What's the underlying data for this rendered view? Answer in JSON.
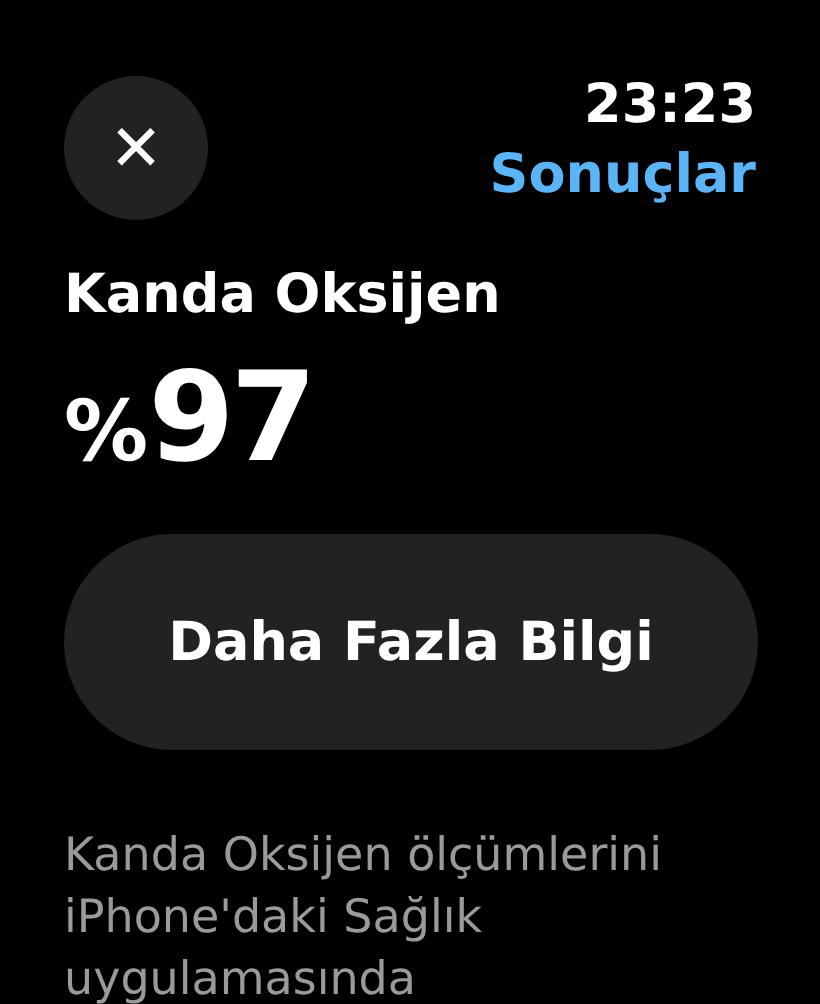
{
  "status_bar": {
    "time": "23:23"
  },
  "header": {
    "close_icon": "✕",
    "back_label": "Sonuçlar"
  },
  "measurement": {
    "title": "Kanda Oksijen",
    "unit": "%",
    "value": "97"
  },
  "button": {
    "label": "Daha Fazla Bilgi"
  },
  "description": "Kanda Oksijen ölçümlerini iPhone'daki Sağlık uygulamasında"
}
